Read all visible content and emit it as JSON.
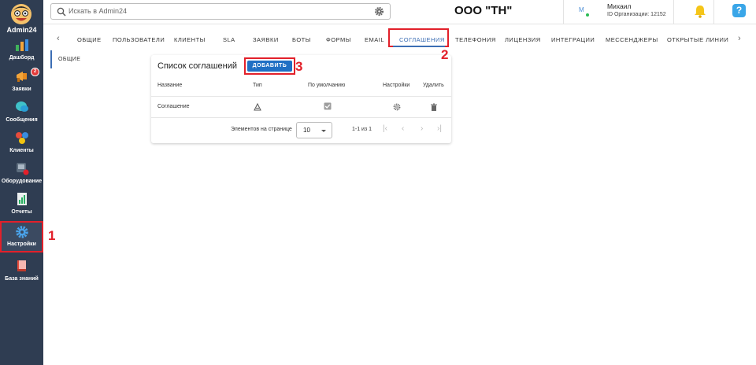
{
  "sidebar": {
    "brand": "Admin24",
    "items": [
      {
        "label": "Дашборд"
      },
      {
        "label": "Заявки",
        "badge": "2"
      },
      {
        "label": "Сообщения"
      },
      {
        "label": "Клиенты"
      },
      {
        "label": "Оборудование"
      },
      {
        "label": "Отчеты"
      },
      {
        "label": "Настройки",
        "active": true
      },
      {
        "label": "База знаний"
      }
    ]
  },
  "header": {
    "search_placeholder": "Искать в Admin24",
    "company": "ООО \"ТН\"",
    "avatar_initial": "M",
    "user_name": "Михаил",
    "org_id": "ID Организации: 12152",
    "help": "?"
  },
  "tabs": [
    {
      "label": "ОБЩИЕ"
    },
    {
      "label": "ПОЛЬЗОВАТЕЛИ"
    },
    {
      "label": "КЛИЕНТЫ"
    },
    {
      "label": "SLA"
    },
    {
      "label": "ЗАЯВКИ"
    },
    {
      "label": "БОТЫ"
    },
    {
      "label": "ФОРМЫ"
    },
    {
      "label": "EMAIL"
    },
    {
      "label": "СОГЛАШЕНИЯ",
      "active": true
    },
    {
      "label": "ТЕЛЕФОНИЯ"
    },
    {
      "label": "ЛИЦЕНЗИЯ"
    },
    {
      "label": "ИНТЕГРАЦИИ"
    },
    {
      "label": "МЕССЕНДЖЕРЫ"
    },
    {
      "label": "ОТКРЫТЫЕ ЛИНИИ"
    }
  ],
  "side_menu": {
    "item": "ОБЩИЕ"
  },
  "agreements": {
    "title": "Список соглашений",
    "add_button": "ДОБАВИТЬ",
    "columns": [
      "Название",
      "Тип",
      "По умолчанию",
      "Настройки",
      "Удалить"
    ],
    "rows": [
      {
        "name": "Соглашение",
        "type_icon": "agreement-type-icon",
        "default_checked": true,
        "settings_icon": "gear-icon",
        "delete_icon": "trash-icon"
      }
    ],
    "pagination": {
      "per_page_label": "Элементов на странице",
      "per_page_value": "10",
      "range": "1-1 из 1"
    }
  },
  "step_markers": [
    "1",
    "2",
    "3"
  ],
  "colors": {
    "sidebar_bg": "#2f3d52",
    "accent": "#1f6fc4",
    "highlight": "#e2202a"
  }
}
